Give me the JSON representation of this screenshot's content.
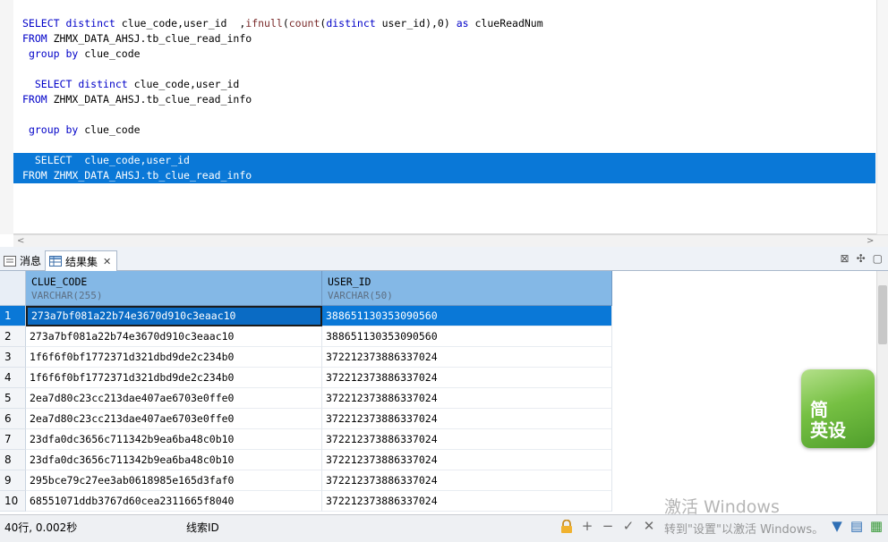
{
  "editor": {
    "lines": [
      {
        "parts": [
          [
            "kw",
            "SELECT distinct "
          ],
          [
            "lit",
            "clue_code,user_id  ,"
          ],
          [
            "fn",
            "ifnull"
          ],
          [
            "lit",
            "("
          ],
          [
            "fn",
            "count"
          ],
          [
            "lit",
            "("
          ],
          [
            "kw",
            "distinct "
          ],
          [
            "lit",
            "user_id),0) "
          ],
          [
            "kw",
            "as "
          ],
          [
            "lit",
            "clueReadNum"
          ]
        ]
      },
      {
        "parts": [
          [
            "kw",
            "FROM "
          ],
          [
            "lit",
            "ZHMX_DATA_AHSJ.tb_clue_read_info"
          ]
        ]
      },
      {
        "parts": [
          [
            "lit",
            " "
          ],
          [
            "kw",
            "group by "
          ],
          [
            "lit",
            "clue_code"
          ]
        ]
      },
      {
        "parts": [
          [
            "lit",
            ""
          ]
        ]
      },
      {
        "parts": [
          [
            "lit",
            "  "
          ],
          [
            "kw",
            "SELECT distinct "
          ],
          [
            "lit",
            "clue_code,user_id"
          ]
        ]
      },
      {
        "parts": [
          [
            "kw",
            "FROM "
          ],
          [
            "lit",
            "ZHMX_DATA_AHSJ.tb_clue_read_info"
          ]
        ]
      },
      {
        "parts": [
          [
            "lit",
            ""
          ]
        ]
      },
      {
        "parts": [
          [
            "lit",
            " "
          ],
          [
            "kw",
            "group by "
          ],
          [
            "lit",
            "clue_code"
          ]
        ]
      },
      {
        "parts": [
          [
            "lit",
            ""
          ]
        ]
      },
      {
        "sel": true,
        "parts": [
          [
            "lit",
            "  "
          ],
          [
            "kw",
            "SELECT  "
          ],
          [
            "lit",
            "clue_code,user_id"
          ]
        ]
      },
      {
        "sel": true,
        "parts": [
          [
            "kw",
            "FROM "
          ],
          [
            "lit",
            "ZHMX_DATA_AHSJ.tb_clue_read_info"
          ]
        ]
      }
    ]
  },
  "tabs": {
    "messages": "消息",
    "result": "结果集",
    "close_glyph": "✕"
  },
  "grid": {
    "columns": [
      {
        "name": "CLUE_CODE",
        "type": "VARCHAR(255)"
      },
      {
        "name": "USER_ID",
        "type": "VARCHAR(50)"
      }
    ],
    "rows": [
      {
        "n": "1",
        "c1": "273a7bf081a22b74e3670d910c3eaac10",
        "c2": "388651130353090560"
      },
      {
        "n": "2",
        "c1": "273a7bf081a22b74e3670d910c3eaac10",
        "c2": "388651130353090560"
      },
      {
        "n": "3",
        "c1": "1f6f6f0bf1772371d321dbd9de2c234b0",
        "c2": "372212373886337024"
      },
      {
        "n": "4",
        "c1": "1f6f6f0bf1772371d321dbd9de2c234b0",
        "c2": "372212373886337024"
      },
      {
        "n": "5",
        "c1": "2ea7d80c23cc213dae407ae6703e0ffe0",
        "c2": "372212373886337024"
      },
      {
        "n": "6",
        "c1": "2ea7d80c23cc213dae407ae6703e0ffe0",
        "c2": "372212373886337024"
      },
      {
        "n": "7",
        "c1": "23dfa0dc3656c711342b9ea6ba48c0b10",
        "c2": "372212373886337024"
      },
      {
        "n": "8",
        "c1": "23dfa0dc3656c711342b9ea6ba48c0b10",
        "c2": "372212373886337024"
      },
      {
        "n": "9",
        "c1": "295bce79c27ee3ab0618985e165d3faf0",
        "c2": "372212373886337024"
      },
      {
        "n": "10",
        "c1": "68551071ddb3767d60cea2311665f8040",
        "c2": "372212373886337024"
      }
    ],
    "selected_row": 0
  },
  "badge": {
    "line1": "简",
    "line2": "英设"
  },
  "watermark": "激活 Windows",
  "status": {
    "rows_info": "40行, 0.002秒",
    "column_name": "线索ID",
    "activation_hint": "转到\"设置\"以激活 Windows。"
  },
  "colors": {
    "keyword": "#0000c8",
    "selection": "#0a78d7",
    "header": "#84b8e6"
  }
}
